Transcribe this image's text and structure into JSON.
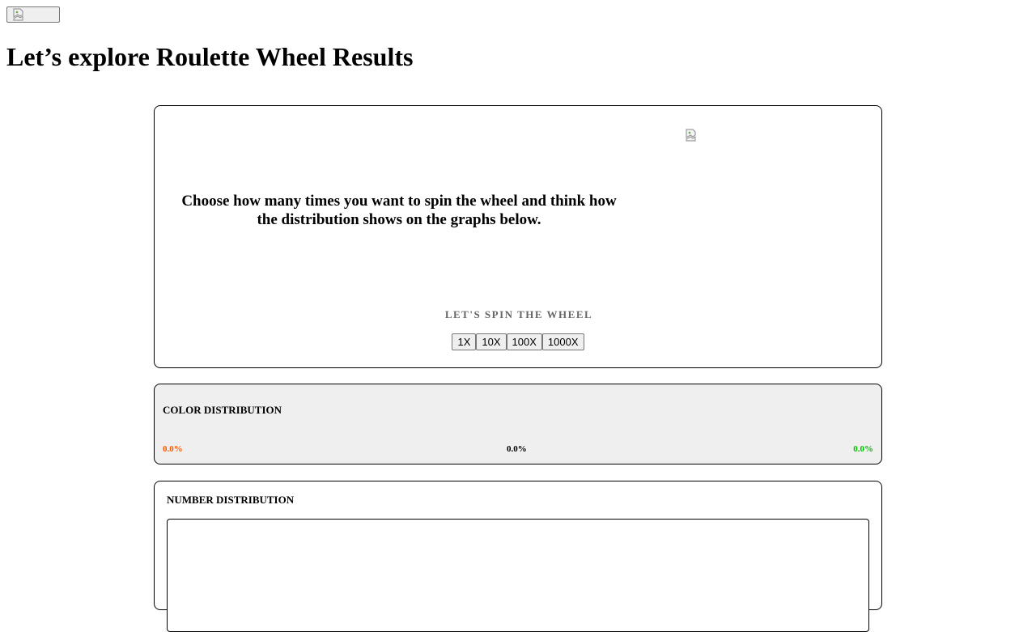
{
  "header": {
    "title": "Let’s explore Roulette Wheel Results"
  },
  "spin_panel": {
    "instructions": "Choose how many times you want to spin the wheel and think how the distribution shows on the graphs below.",
    "spin_label": "LET'S SPIN THE WHEEL",
    "buttons": [
      "1X",
      "10X",
      "100X",
      "1000X"
    ]
  },
  "color_distribution": {
    "title": "COLOR DISTRIBUTION",
    "red_pct": "0.0%",
    "black_pct": "0.0%",
    "green_pct": "0.0%",
    "colors": {
      "red": "#ff5a00",
      "black": "#000000",
      "green": "#00c000"
    }
  },
  "number_distribution": {
    "title": "NUMBER DISTRIBUTION"
  },
  "icons": {
    "broken_image": "broken-image-icon"
  }
}
